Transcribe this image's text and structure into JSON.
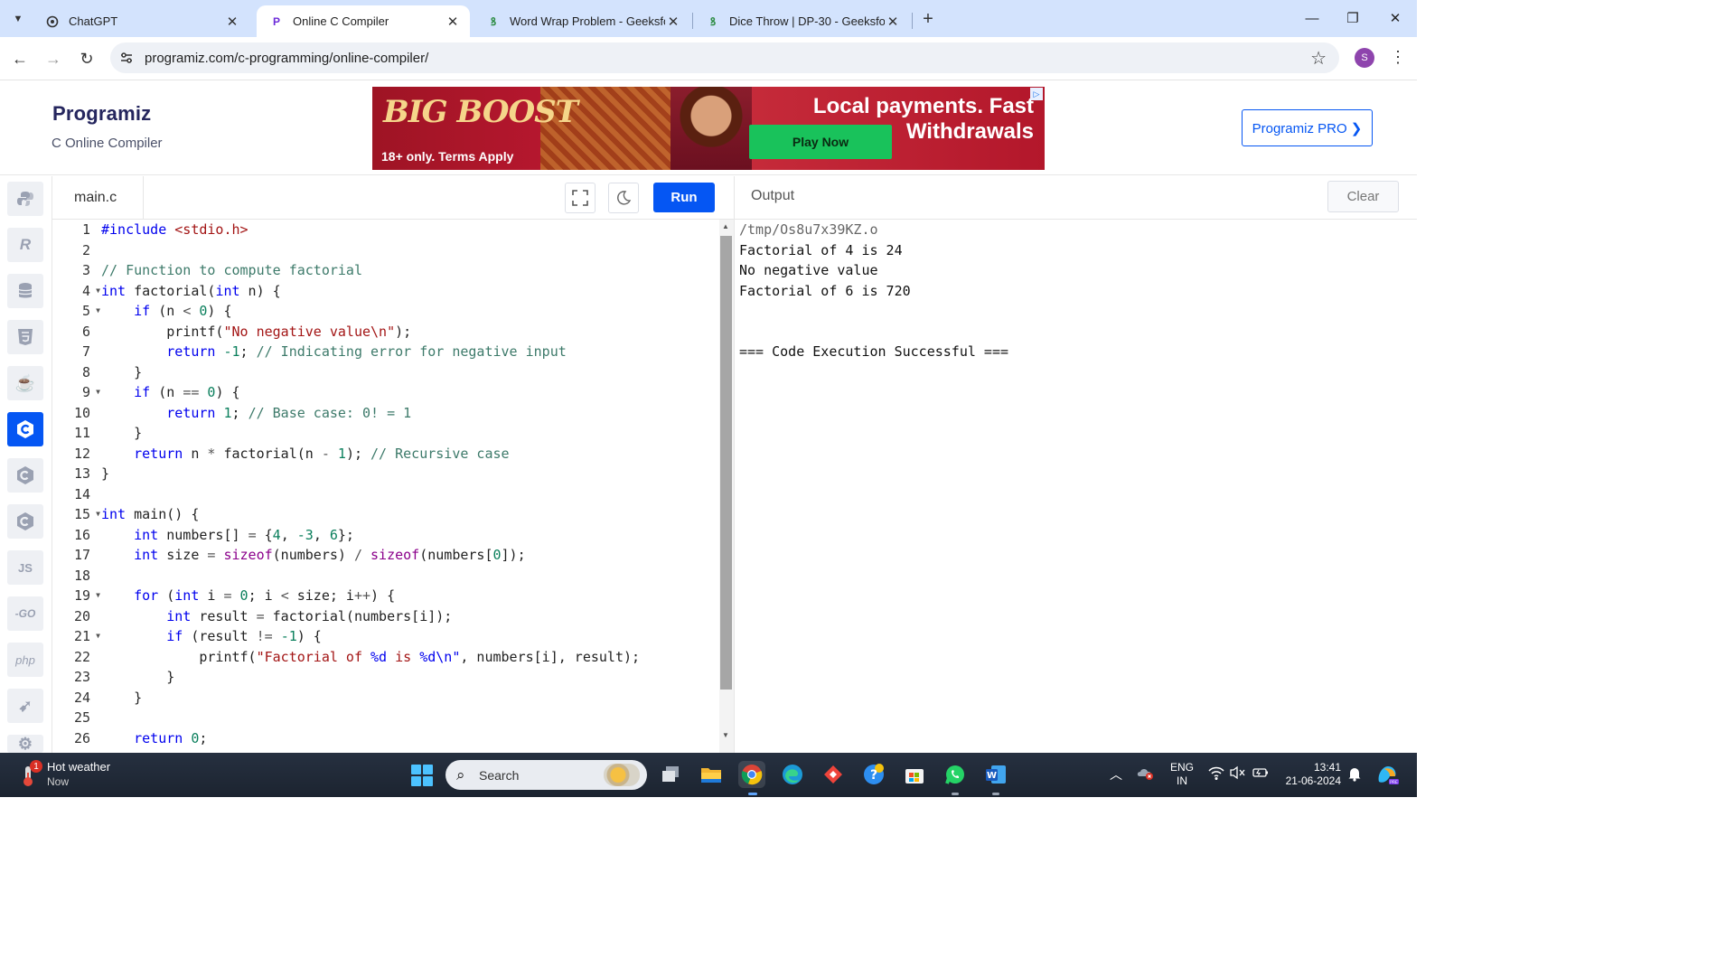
{
  "browser": {
    "tabs": [
      {
        "title": "ChatGPT",
        "icon": "chatgpt-icon",
        "active": false
      },
      {
        "title": "Online C Compiler",
        "icon": "programiz-icon",
        "active": true
      },
      {
        "title": "Word Wrap Problem - GeeksforGeeks",
        "icon": "geeksforgeeks-icon",
        "active": false
      },
      {
        "title": "Dice Throw | DP-30 - GeeksforGeeks",
        "icon": "geeksforgeeks-icon",
        "active": false
      }
    ],
    "url": "programiz.com/c-programming/online-compiler/",
    "profile_initial": "S"
  },
  "header": {
    "logo": "Programiz",
    "subtitle": "C Online Compiler",
    "pro_button": "Programiz PRO ❯",
    "ad": {
      "brand": "BIG BOOST",
      "terms": "18+ only. Terms Apply",
      "headline": "Local payments. Fast Withdrawals",
      "cta": "Play Now"
    }
  },
  "sidebar": {
    "languages": [
      {
        "name": "python",
        "glyph": "🐍"
      },
      {
        "name": "r",
        "glyph": "R"
      },
      {
        "name": "sql",
        "glyph": "≣"
      },
      {
        "name": "html",
        "glyph": "5"
      },
      {
        "name": "java",
        "glyph": "☕"
      },
      {
        "name": "c",
        "glyph": "C",
        "active": true
      },
      {
        "name": "cpp",
        "glyph": "C"
      },
      {
        "name": "csharp",
        "glyph": "C"
      },
      {
        "name": "javascript",
        "glyph": "JS"
      },
      {
        "name": "go",
        "glyph": "-GO"
      },
      {
        "name": "php",
        "glyph": "php"
      },
      {
        "name": "swift",
        "glyph": "➹"
      },
      {
        "name": "rust",
        "glyph": "⚙"
      }
    ]
  },
  "editor": {
    "filename": "main.c",
    "run_label": "Run",
    "fold_lines": [
      4,
      5,
      9,
      15,
      19,
      21
    ],
    "lines": [
      [
        [
          "#include ",
          "kw"
        ],
        [
          "<stdio.h>",
          "inc"
        ]
      ],
      [],
      [
        [
          "// Function to compute factorial",
          "cm"
        ]
      ],
      [
        [
          "int",
          "kw"
        ],
        [
          " factorial(",
          "fn"
        ],
        [
          "int",
          "kw"
        ],
        [
          " n) {",
          "fn"
        ]
      ],
      [
        [
          "    ",
          "fn"
        ],
        [
          "if",
          "kw"
        ],
        [
          " (n ",
          "fn"
        ],
        [
          "<",
          "op"
        ],
        [
          " ",
          "fn"
        ],
        [
          "0",
          "num"
        ],
        [
          ") {",
          "fn"
        ]
      ],
      [
        [
          "        printf(",
          "fn"
        ],
        [
          "\"No negative value\\n\"",
          "str"
        ],
        [
          ");",
          "fn"
        ]
      ],
      [
        [
          "        ",
          "fn"
        ],
        [
          "return",
          "kw"
        ],
        [
          " ",
          "fn"
        ],
        [
          "-1",
          "num"
        ],
        [
          "; ",
          "fn"
        ],
        [
          "// Indicating error for negative input",
          "cm"
        ]
      ],
      [
        [
          "    }",
          "fn"
        ]
      ],
      [
        [
          "    ",
          "fn"
        ],
        [
          "if",
          "kw"
        ],
        [
          " (n ",
          "fn"
        ],
        [
          "==",
          "op"
        ],
        [
          " ",
          "fn"
        ],
        [
          "0",
          "num"
        ],
        [
          ") {",
          "fn"
        ]
      ],
      [
        [
          "        ",
          "fn"
        ],
        [
          "return",
          "kw"
        ],
        [
          " ",
          "fn"
        ],
        [
          "1",
          "num"
        ],
        [
          "; ",
          "fn"
        ],
        [
          "// Base case: 0! = 1",
          "cm"
        ]
      ],
      [
        [
          "    }",
          "fn"
        ]
      ],
      [
        [
          "    ",
          "fn"
        ],
        [
          "return",
          "kw"
        ],
        [
          " n ",
          "fn"
        ],
        [
          "*",
          "op"
        ],
        [
          " factorial(n ",
          "fn"
        ],
        [
          "-",
          "op"
        ],
        [
          " ",
          "fn"
        ],
        [
          "1",
          "num"
        ],
        [
          "); ",
          "fn"
        ],
        [
          "// Recursive case",
          "cm"
        ]
      ],
      [
        [
          "}",
          "fn"
        ]
      ],
      [],
      [
        [
          "int",
          "kw"
        ],
        [
          " main() {",
          "fn"
        ]
      ],
      [
        [
          "    ",
          "fn"
        ],
        [
          "int",
          "kw"
        ],
        [
          " numbers[] ",
          "fn"
        ],
        [
          "=",
          "op"
        ],
        [
          " {",
          "fn"
        ],
        [
          "4",
          "num"
        ],
        [
          ", ",
          "fn"
        ],
        [
          "-3",
          "num"
        ],
        [
          ", ",
          "fn"
        ],
        [
          "6",
          "num"
        ],
        [
          "};",
          "fn"
        ]
      ],
      [
        [
          "    ",
          "fn"
        ],
        [
          "int",
          "kw"
        ],
        [
          " size ",
          "fn"
        ],
        [
          "=",
          "op"
        ],
        [
          " ",
          "fn"
        ],
        [
          "sizeof",
          "kw2"
        ],
        [
          "(numbers) ",
          "fn"
        ],
        [
          "/",
          "op"
        ],
        [
          " ",
          "fn"
        ],
        [
          "sizeof",
          "kw2"
        ],
        [
          "(numbers[",
          "fn"
        ],
        [
          "0",
          "num"
        ],
        [
          "]);",
          "fn"
        ]
      ],
      [],
      [
        [
          "    ",
          "fn"
        ],
        [
          "for",
          "kw"
        ],
        [
          " (",
          "fn"
        ],
        [
          "int",
          "kw"
        ],
        [
          " i ",
          "fn"
        ],
        [
          "=",
          "op"
        ],
        [
          " ",
          "fn"
        ],
        [
          "0",
          "num"
        ],
        [
          "; i ",
          "fn"
        ],
        [
          "<",
          "op"
        ],
        [
          " size; i",
          "fn"
        ],
        [
          "++",
          "op"
        ],
        [
          ") {",
          "fn"
        ]
      ],
      [
        [
          "        ",
          "fn"
        ],
        [
          "int",
          "kw"
        ],
        [
          " result ",
          "fn"
        ],
        [
          "=",
          "op"
        ],
        [
          " factorial(numbers[i]);",
          "fn"
        ]
      ],
      [
        [
          "        ",
          "fn"
        ],
        [
          "if",
          "kw"
        ],
        [
          " (result ",
          "fn"
        ],
        [
          "!=",
          "op"
        ],
        [
          " ",
          "fn"
        ],
        [
          "-1",
          "num"
        ],
        [
          ") {",
          "fn"
        ]
      ],
      [
        [
          "            printf(",
          "fn"
        ],
        [
          "\"Factorial of ",
          "str"
        ],
        [
          "%d",
          "kw"
        ],
        [
          " is ",
          "str"
        ],
        [
          "%d\\n\"",
          "kw"
        ],
        [
          ", numbers[i], result);",
          "fn"
        ]
      ],
      [
        [
          "        }",
          "fn"
        ]
      ],
      [
        [
          "    }",
          "fn"
        ]
      ],
      [],
      [
        [
          "    ",
          "fn"
        ],
        [
          "return",
          "kw"
        ],
        [
          " ",
          "fn"
        ],
        [
          "0",
          "num"
        ],
        [
          ";",
          "fn"
        ]
      ]
    ]
  },
  "output": {
    "title": "Output",
    "clear_label": "Clear",
    "lines": [
      {
        "text": "/tmp/Os8u7x39KZ.o",
        "kind": "path"
      },
      {
        "text": "Factorial of 4 is 24",
        "kind": "out"
      },
      {
        "text": "No negative value",
        "kind": "out"
      },
      {
        "text": "Factorial of 6 is 720",
        "kind": "out"
      },
      {
        "text": "",
        "kind": "out"
      },
      {
        "text": "",
        "kind": "out"
      },
      {
        "text": "=== Code Execution Successful ===",
        "kind": "out"
      }
    ]
  },
  "taskbar": {
    "weather_title": "Hot weather",
    "weather_sub": "Now",
    "weather_badge": "1",
    "search_label": "Search",
    "lang_line1": "ENG",
    "lang_line2": "IN",
    "time": "13:41",
    "date": "21-06-2024"
  }
}
